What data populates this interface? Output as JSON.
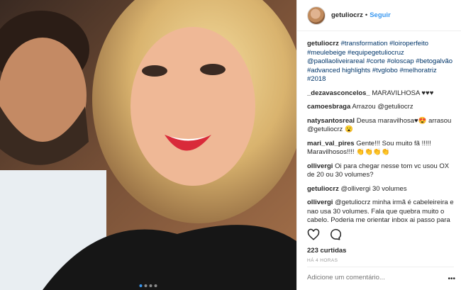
{
  "post": {
    "image_alt": "selfie photo",
    "carousel_dots": 4,
    "active_dot": 1
  },
  "header": {
    "username": "getuliocrz",
    "separator": "•",
    "follow_label": "Seguir"
  },
  "caption": {
    "username": "getuliocrz",
    "text": "#transformation #loiroperfeito #meulebeige #equipegetuliocruz @paollaoliveirareal #corte #oloscap #betogalvão #advanced highlights #tvglobo #melhoratriz #2018"
  },
  "comments": [
    {
      "username": "_dezavasconcelos_",
      "text": "MARAVILHOSA ♥♥♥"
    },
    {
      "username": "camoesbraga",
      "text": "Arrazou @getuliocrz"
    },
    {
      "username": "natysantosreal",
      "text": "Deusa maravilhosa♥😍 arrasou @getuliocrz 😮"
    },
    {
      "username": "mari_val_pires",
      "text": "Gente!!! Sou muito fã !!!!! Maravilhosos!!!! 👏👏👏👏"
    },
    {
      "username": "ollivergi",
      "text": "Oi para chegar nesse tom vc usou OX de 20 ou 30 volumes?"
    },
    {
      "username": "getuliocrz",
      "text": "@ollivergi 30 volumes"
    },
    {
      "username": "ollivergi",
      "text": "@getuliocrz minha irmã é cabeleireira e nao usa 30 volumes. Fala que quebra muito o cabelo. Poderia me orientar inbox ai passo para ela?"
    }
  ],
  "likes": "223 curtidas",
  "timestamp": "HÁ 4 HORAS",
  "add_comment_placeholder": "Adicione um comentário...",
  "icons": {
    "like": "heart-icon",
    "comment": "comment-bubble-icon",
    "more": "more-options-icon"
  }
}
